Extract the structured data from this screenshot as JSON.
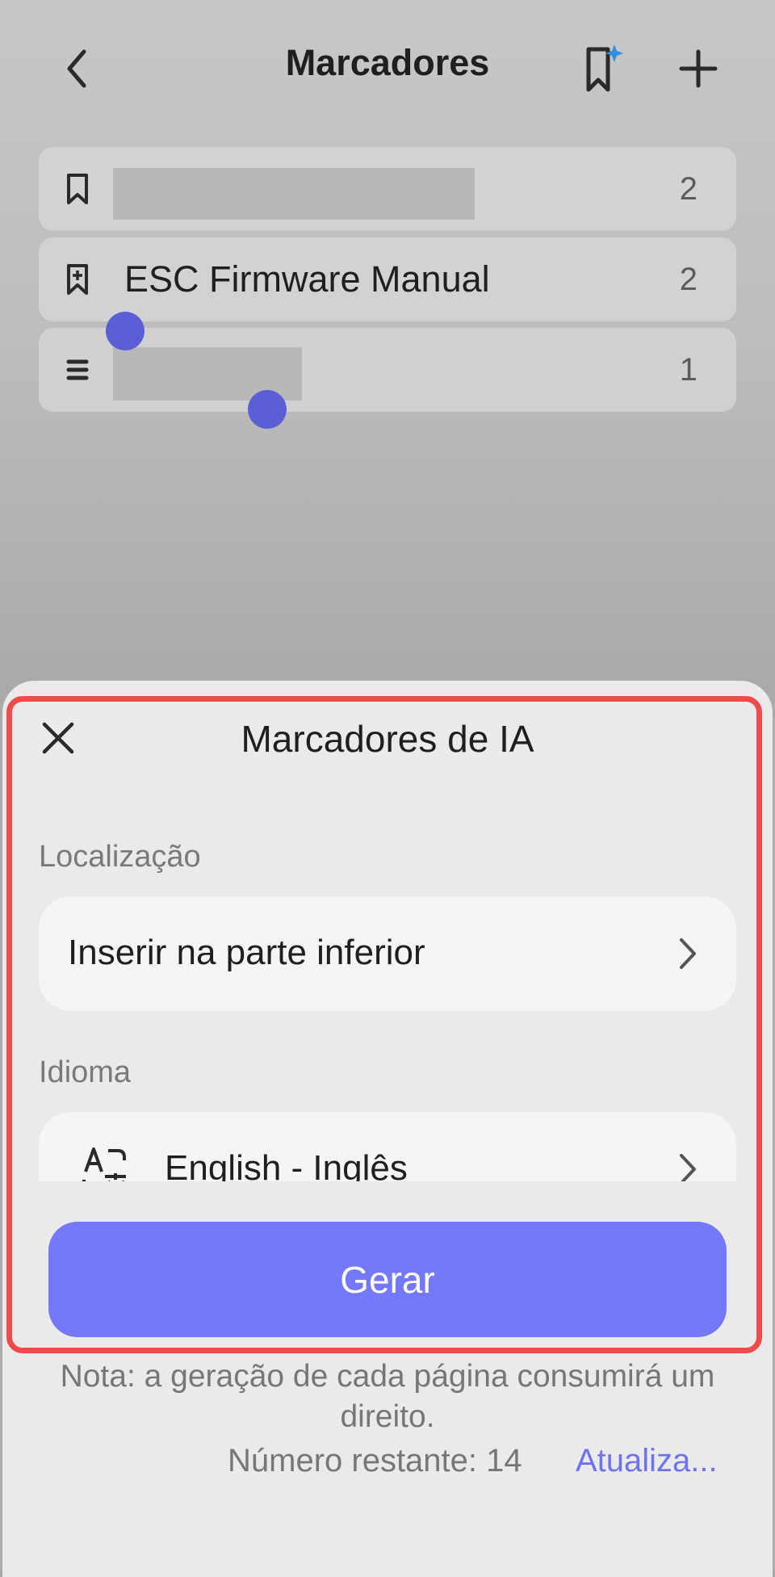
{
  "header": {
    "title": "Marcadores",
    "back_icon": "chevron-left-icon",
    "ai_bookmark_icon": "bookmark-sparkle-icon",
    "add_icon": "plus-icon"
  },
  "bookmarks": [
    {
      "icon": "bookmark-icon",
      "label": "",
      "count": "2"
    },
    {
      "icon": "bookmark-plus-icon",
      "label": "ESC Firmware Manual",
      "count": "2"
    },
    {
      "icon": "list-icon",
      "label": "",
      "count": "1"
    }
  ],
  "sheet": {
    "title": "Marcadores de IA",
    "location_label": "Localização",
    "location_value": "Inserir na parte inferior",
    "language_label": "Idioma",
    "language_value": "English - Inglês",
    "generate_label": "Gerar",
    "note": "Nota: a geração de cada página consumirá um direito.",
    "remaining": "Número restante: 14",
    "upgrade": "Atualiza..."
  },
  "colors": {
    "accent": "#7478fb",
    "link": "#6f73f2",
    "highlight_border": "#f04a4a",
    "selection_handle": "#5a5fd6"
  }
}
